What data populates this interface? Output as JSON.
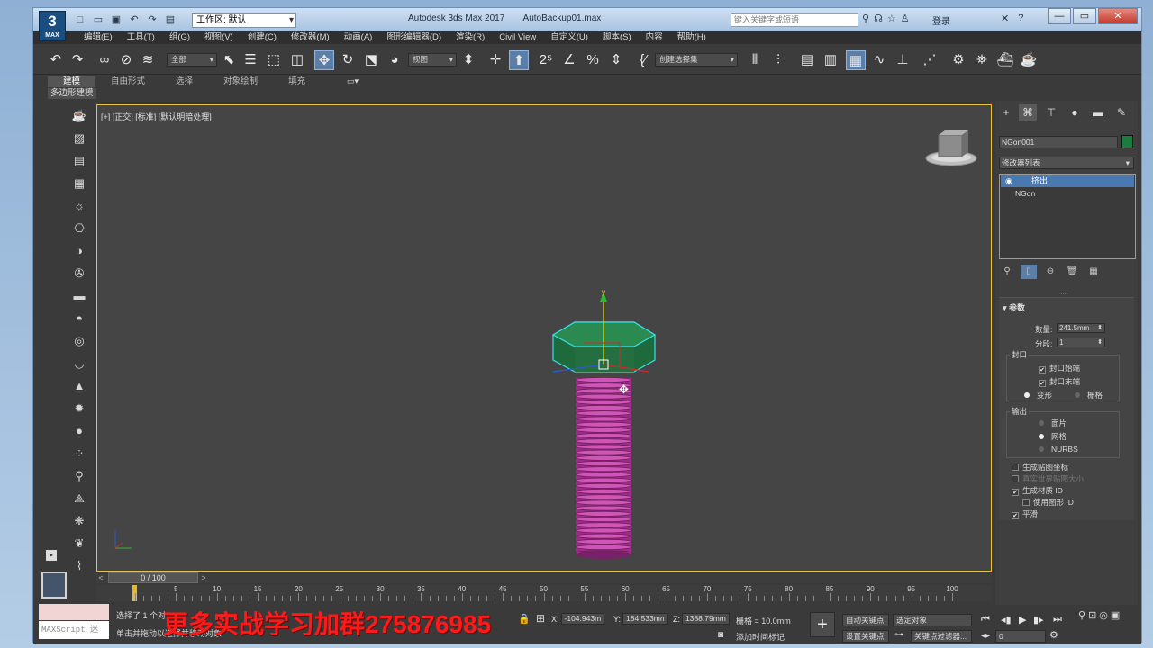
{
  "title": {
    "app_logo_number": "3",
    "app_logo_text": "MAX",
    "workspace_label": "工作区: 默认",
    "app_name": "Autodesk 3ds Max 2017",
    "file_name": "AutoBackup01.max",
    "search_placeholder": "键入关键字或短语",
    "login_label": "登录"
  },
  "menu": [
    "编辑(E)",
    "工具(T)",
    "组(G)",
    "视图(V)",
    "创建(C)",
    "修改器(M)",
    "动画(A)",
    "图形编辑器(D)",
    "渲染(R)",
    "Civil View",
    "自定义(U)",
    "脚本(S)",
    "内容",
    "帮助(H)"
  ],
  "toolbar": {
    "filter_dropdown": "全部",
    "refcoord_dropdown": "视图",
    "selection_set": "创建选择集"
  },
  "ribbon": {
    "tabs": [
      "建模",
      "自由形式",
      "选择",
      "对象绘制",
      "填充"
    ],
    "subpanel": "多边形建模"
  },
  "viewport": {
    "label": "[+] [正交] [标准] [默认明暗处理]",
    "gizmo_y_label": "y",
    "colors": {
      "bolt_thread": "#b23a9a",
      "bolt_head": "#1f6a3c",
      "selection": "#38e0e8"
    }
  },
  "timeline": {
    "slider_label": "0 / 100",
    "ticks": [
      0,
      5,
      10,
      15,
      20,
      25,
      30,
      35,
      40,
      45,
      50,
      55,
      60,
      65,
      70,
      75,
      80,
      85,
      90,
      95,
      100
    ]
  },
  "status": {
    "maxscript_label": "MAXScript 迷",
    "selected_text": "选择了 1 个对",
    "hint_text": "单击并拖动以选择并移动对象",
    "watermark": "更多实战学习加群275876985",
    "x_label": "X:",
    "x_value": "-104.943m",
    "y_label": "Y:",
    "y_value": "184.533mn",
    "z_label": "Z:",
    "z_value": "1388.79mm",
    "grid_text": "栅格 = 10.0mm",
    "add_time_tag": "添加时间标记",
    "auto_key": "自动关键点",
    "set_key": "设置关键点",
    "selected_object": "选定对象",
    "key_filters": "关键点过滤器...",
    "frame_value": "0"
  },
  "command_panel": {
    "object_name": "NGon001",
    "object_color": "#1a7d3f",
    "modifier_list": "修改器列表",
    "stack": [
      "挤出",
      "NGon"
    ],
    "rollout_title": "参数",
    "amount_label": "数量:",
    "amount_value": "241.5mm",
    "segments_label": "分段:",
    "segments_value": "1",
    "capping_group": "封口",
    "cap_start": "封口始端",
    "cap_end": "封口末端",
    "morph": "变形",
    "grid": "栅格",
    "output_group": "输出",
    "patch": "面片",
    "mesh": "网格",
    "nurbs": "NURBS",
    "gen_mapping": "生成贴图坐标",
    "real_world": "真实世界贴图大小",
    "gen_mat_ids": "生成材质 ID",
    "use_shape_ids": "使用图形 ID",
    "smooth": "平滑"
  }
}
